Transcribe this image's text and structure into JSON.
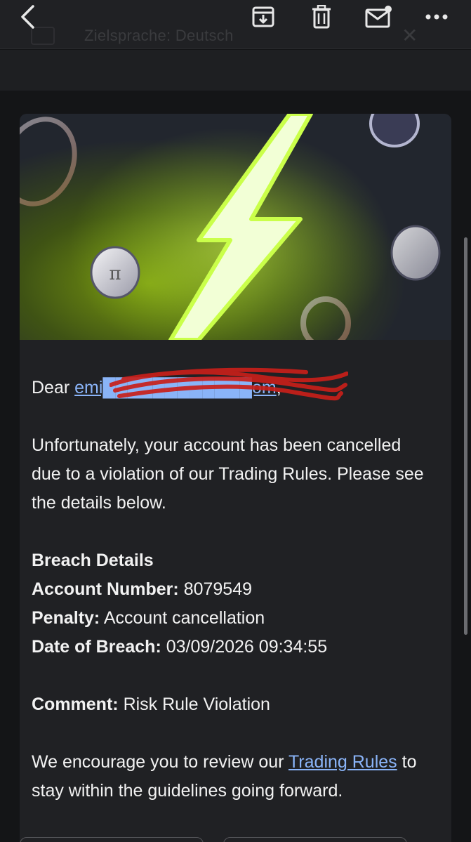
{
  "toolbar": {
    "back_icon": "chevron-left-icon",
    "archive_icon": "archive-icon",
    "delete_icon": "trash-icon",
    "mark_unread_icon": "mail-unread-icon",
    "more_icon": "more-horizontal-icon"
  },
  "ghost_header": {
    "text": "Zielsprache: Deutsch"
  },
  "email": {
    "greeting_prefix": "Dear",
    "recipient": "emi████████████om",
    "greeting_suffix": ",",
    "intro": "Unfortunately, your account has been cancelled due to a violation of our Trading Rules. Please see the details below.",
    "breach_heading": "Breach Details",
    "account_label": "Account Number:",
    "account_value": "8079549",
    "penalty_label": "Penalty:",
    "penalty_value": "Account cancellation",
    "date_label": "Date of Breach:",
    "date_value": "03/09/2026 09:34:55",
    "comment_label": "Comment:",
    "comment_value": "Risk Rule Violation",
    "outro_before": "We encourage you to review our",
    "outro_link": "Trading Rules",
    "outro_after": "to stay within the guidelines going forward."
  },
  "colors": {
    "background": "#141517",
    "card": "#202124",
    "text": "#f2f2f2",
    "link": "#8ab4f8",
    "accent_lightning": "#c6ff3a",
    "redaction": "#c8201a"
  }
}
